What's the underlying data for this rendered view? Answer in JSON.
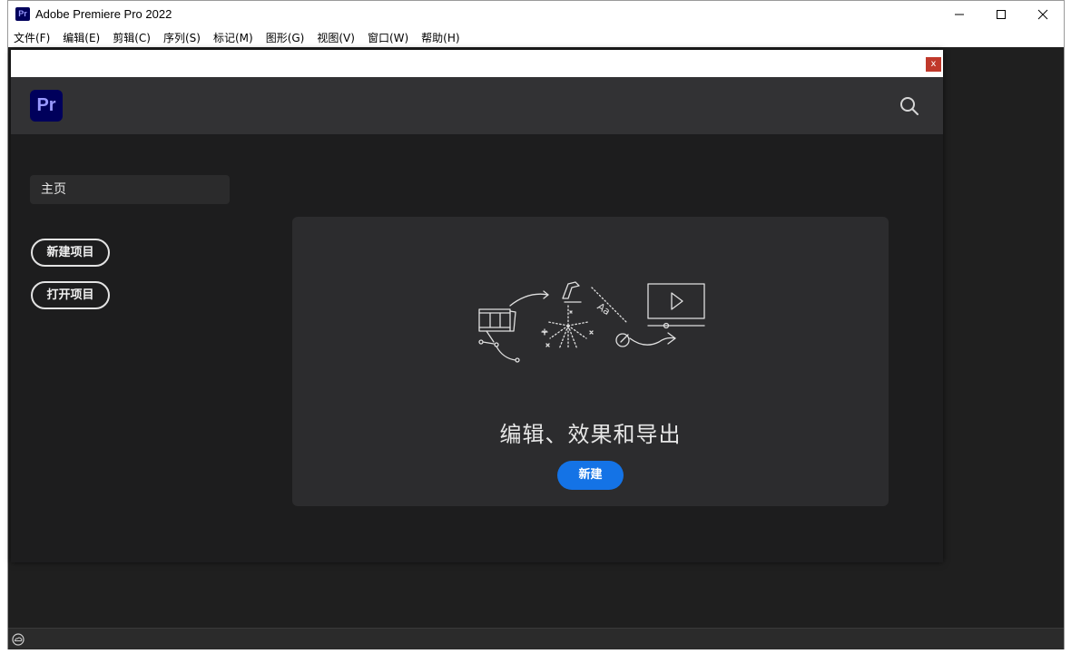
{
  "window": {
    "title": "Adobe Premiere Pro 2022",
    "app_icon_text": "Pr"
  },
  "menu": [
    "文件(F)",
    "编辑(E)",
    "剪辑(C)",
    "序列(S)",
    "标记(M)",
    "图形(G)",
    "视图(V)",
    "窗口(W)",
    "帮助(H)"
  ],
  "home": {
    "close_label": "x",
    "logo_text": "Pr",
    "nav_home": "主页",
    "new_project": "新建项目",
    "open_project": "打开项目",
    "card_title": "编辑、效果和导出",
    "card_button": "新建"
  },
  "colors": {
    "accent": "#1473e6",
    "pr_logo_bg": "#00005b",
    "pr_logo_fg": "#9999ff"
  }
}
